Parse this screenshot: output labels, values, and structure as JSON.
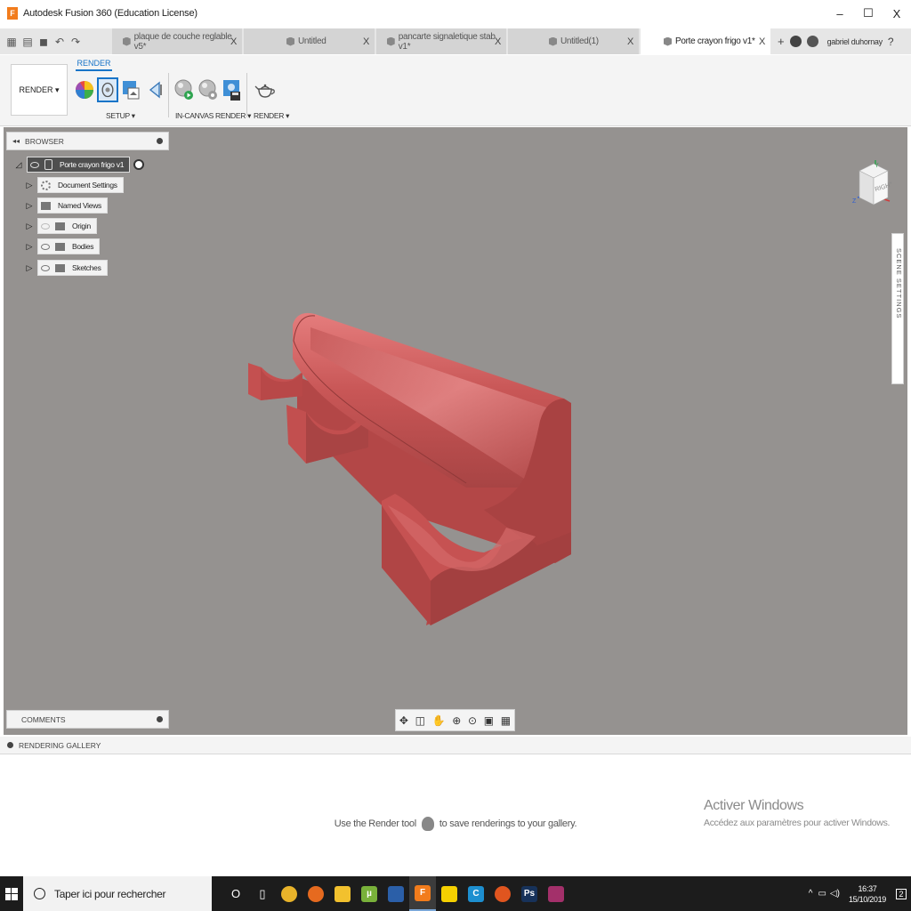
{
  "window": {
    "title": "Autodesk Fusion 360 (Education License)",
    "logo_letter": "F",
    "minimize": "–",
    "maximize": "☐",
    "close": "X"
  },
  "tabs": [
    {
      "label": "plaque de couche reglable v5*",
      "close": "X",
      "active": false
    },
    {
      "label": "Untitled",
      "close": "X",
      "active": false
    },
    {
      "label": "pancarte signaletique stab v1*",
      "close": "X",
      "active": false
    },
    {
      "label": "Untitled(1)",
      "close": "X",
      "active": false
    },
    {
      "label": "Porte crayon frigo v1*",
      "close": "X",
      "active": true
    }
  ],
  "tabbar": {
    "new_tab": "+",
    "user_name": "gabriel duhornay"
  },
  "toolbar": {
    "workspace": "RENDER ▾",
    "active_tab": "RENDER",
    "groups": [
      {
        "label": "SETUP ▾"
      },
      {
        "label": "IN-CANVAS RENDER ▾"
      },
      {
        "label": "RENDER ▾"
      }
    ]
  },
  "browser": {
    "title": "BROWSER",
    "collapse": "◂◂",
    "root": "Porte crayon frigo v1",
    "items": [
      {
        "label": "Document Settings",
        "icon": "gear-icon"
      },
      {
        "label": "Named Views",
        "icon": "folder-icon"
      },
      {
        "label": "Origin",
        "icon": "folder-icon"
      },
      {
        "label": "Bodies",
        "icon": "folder-icon"
      },
      {
        "label": "Sketches",
        "icon": "folder-icon"
      }
    ]
  },
  "viewcube": {
    "face": "RIGHT",
    "axis_y": "Y",
    "axis_z": "Z"
  },
  "scene_settings": "SCENE SETTINGS",
  "comments": {
    "title": "COMMENTS"
  },
  "gallery": {
    "title": "RENDERING GALLERY",
    "msg_before": "Use the Render tool",
    "msg_after": "to save renderings to your gallery."
  },
  "watermark": {
    "line1": "Activer Windows",
    "line2": "Accédez aux paramètres pour activer Windows."
  },
  "taskbar": {
    "search_placeholder": "Taper ici pour rechercher",
    "apps": [
      {
        "name": "cortana-icon",
        "glyph": "O",
        "color": "#1c1c1c"
      },
      {
        "name": "task-view-icon",
        "glyph": "▯",
        "color": "#1c1c1c"
      },
      {
        "name": "chrome-icon",
        "glyph": "",
        "color": "#e8b32a"
      },
      {
        "name": "firefox-icon",
        "glyph": "",
        "color": "#e66a1f"
      },
      {
        "name": "file-explorer-icon",
        "glyph": "",
        "color": "#f2c12e"
      },
      {
        "name": "utorrent-icon",
        "glyph": "µ",
        "color": "#79b13a"
      },
      {
        "name": "avast-icon",
        "glyph": "",
        "color": "#2b5fa8"
      },
      {
        "name": "fusion-360-icon",
        "glyph": "F",
        "color": "#f27c1c"
      },
      {
        "name": "sticky-notes-icon",
        "glyph": "",
        "color": "#f5d000"
      },
      {
        "name": "ccleaner-icon",
        "glyph": "C",
        "color": "#1d8fd0"
      },
      {
        "name": "firefox-2-icon",
        "glyph": "",
        "color": "#e0551f"
      },
      {
        "name": "photoshop-icon",
        "glyph": "Ps",
        "color": "#17325a"
      },
      {
        "name": "winrar-icon",
        "glyph": "",
        "color": "#a3306a"
      }
    ],
    "time": "16:37",
    "date": "15/10/2019",
    "notifications": "2"
  }
}
